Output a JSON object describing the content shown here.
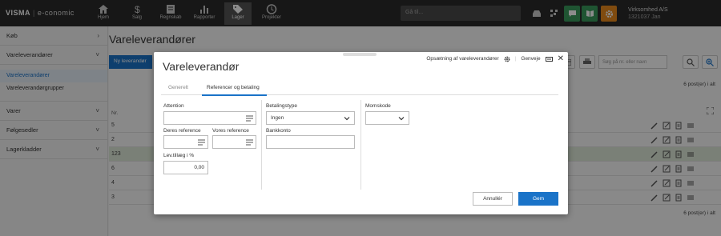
{
  "topbar": {
    "brand": "VISMA",
    "product": "e-conomic",
    "nav": [
      {
        "label": "Hjem",
        "icon": "home-icon"
      },
      {
        "label": "Salg",
        "icon": "dollar-icon"
      },
      {
        "label": "Regnskab",
        "icon": "ledger-icon"
      },
      {
        "label": "Rapporter",
        "icon": "bar-chart-icon"
      },
      {
        "label": "Lager",
        "icon": "tag-icon"
      },
      {
        "label": "Projekter",
        "icon": "clock-icon"
      }
    ],
    "search_placeholder": "Gå til...",
    "company_name": "Virksomhed A/S",
    "company_sub": "1321037 Jan"
  },
  "sidebar": {
    "sections": [
      {
        "label": "Køb"
      },
      {
        "label": "Vareleverandører"
      }
    ],
    "subitems": [
      {
        "label": "Vareleverandører"
      },
      {
        "label": "Vareleverandørgrupper"
      }
    ],
    "more_sections": [
      {
        "label": "Varer"
      },
      {
        "label": "Følgesedler"
      },
      {
        "label": "Lagerkladder"
      }
    ]
  },
  "main": {
    "title": "Vareleverandører",
    "new_button": "Ny leverandør",
    "search_placeholder": "Søg på nr. eller navn",
    "count_top": "6 post(er) i alt",
    "count_bottom": "6 post(er) i alt",
    "col_number": "Nr.",
    "rows": [
      {
        "num": "5"
      },
      {
        "num": "2"
      },
      {
        "num": "123"
      },
      {
        "num": "6"
      },
      {
        "num": "4"
      },
      {
        "num": "3"
      }
    ]
  },
  "modal": {
    "title": "Vareleverandør",
    "setup_link": "Opsætning af vareleverandører",
    "shortcuts_link": "Genveje",
    "tabs": [
      {
        "label": "Generelt"
      },
      {
        "label": "Referencer og betaling"
      }
    ],
    "fields": {
      "attention_label": "Attention",
      "deres_reference_label": "Deres reference",
      "vores_reference_label": "Vores reference",
      "lev_tillaeg_label": "Lev.tillæg i %",
      "lev_tillaeg_value": "0,00",
      "betalingstype_label": "Betalingstype",
      "betalingstype_value": "Ingen",
      "bankkonto_label": "Bankkonto",
      "momskode_label": "Momskode"
    },
    "cancel_button": "Annullér",
    "save_button": "Gem"
  },
  "colors": {
    "accent": "#1a73c8",
    "topbar": "#2b2b2b",
    "green_button": "#3a9a5b",
    "orange_button": "#e8891c"
  }
}
